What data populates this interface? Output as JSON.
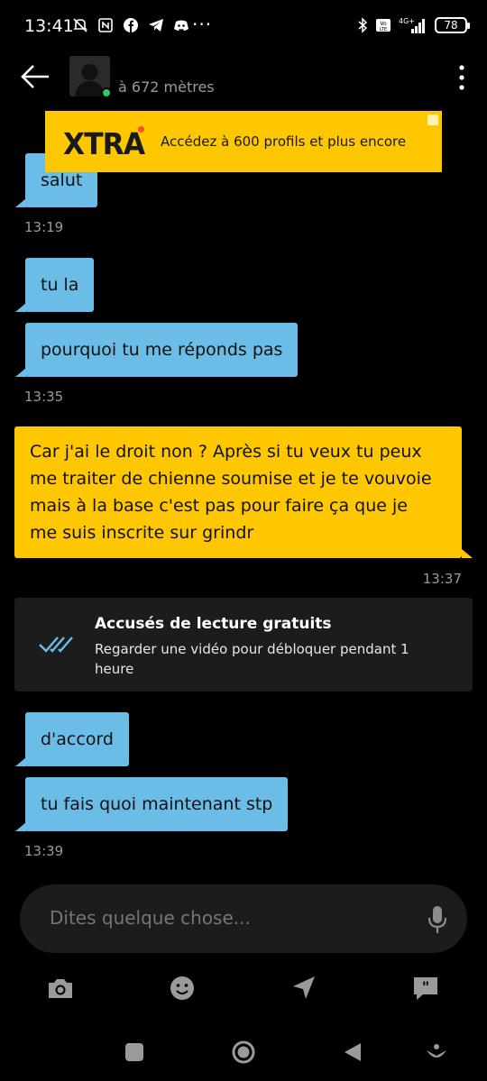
{
  "status_bar": {
    "time": "13:41",
    "dots": "···",
    "battery": "78"
  },
  "header": {
    "distance": "à 672 mètres"
  },
  "ad": {
    "logo": "XTRA",
    "text": "Accédez à 600 profils et plus encore"
  },
  "messages": [
    {
      "dir": "in",
      "text": "salut"
    },
    {
      "time": "13:19"
    },
    {
      "dir": "in",
      "text": "tu la"
    },
    {
      "dir": "in",
      "text": "pourquoi tu me réponds pas"
    },
    {
      "time": "13:35"
    },
    {
      "dir": "out",
      "lines": [
        "Car j'ai le droit non ? Après si tu veux tu peux",
        "me traiter de chienne soumise et je te vouvoie",
        "mais à la base c'est pas pour faire ça que je",
        "me suis inscrite sur grindr"
      ]
    },
    {
      "time": "13:37"
    },
    {
      "dir": "in",
      "text": "d'accord"
    },
    {
      "dir": "in",
      "text": "tu fais quoi maintenant stp"
    },
    {
      "time": "13:39"
    }
  ],
  "receipt_card": {
    "title": "Accusés de lecture gratuits",
    "subtitle": "Regarder une vidéo pour débloquer pendant 1 heure"
  },
  "composer": {
    "placeholder": "Dites quelque chose..."
  },
  "colors": {
    "incoming_bubble": "#6bbde7",
    "outgoing_bubble": "#fec700",
    "ad_background": "#fec700",
    "online": "#2ecc5f",
    "receipt_check": "#6bbde7"
  },
  "icons": {
    "toolbar": [
      "camera-icon",
      "smiley-icon",
      "location-arrow-icon",
      "saved-phrases-icon"
    ],
    "nav": [
      "recents-icon",
      "home-icon",
      "back-triangle-icon",
      "assistant-icon"
    ]
  }
}
